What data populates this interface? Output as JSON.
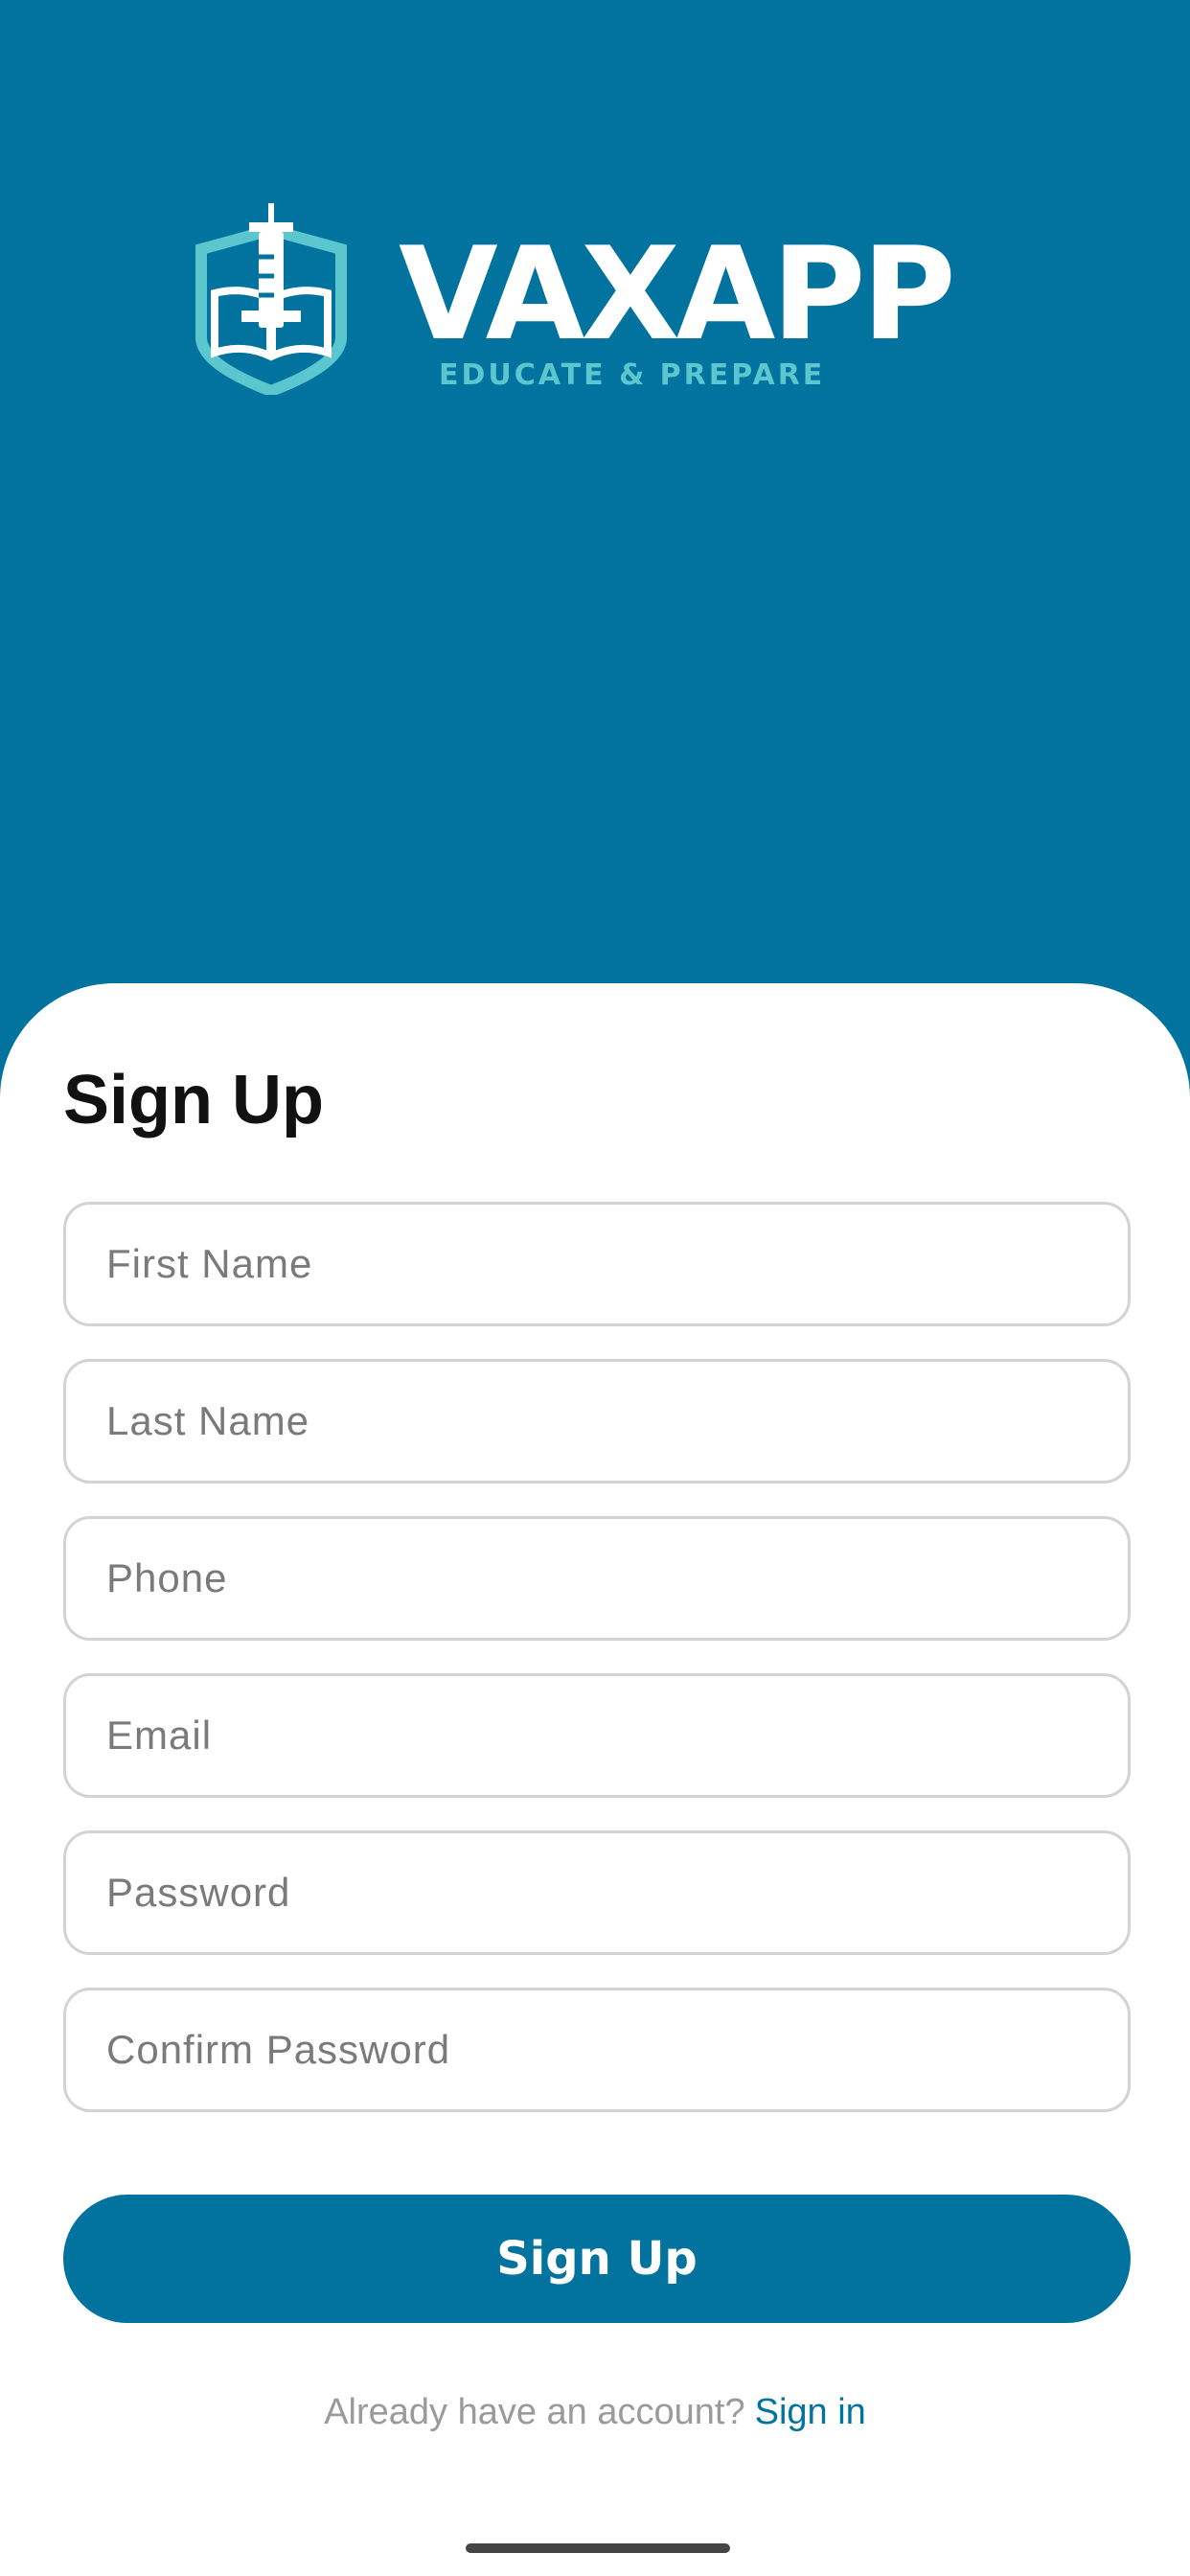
{
  "brand": {
    "name": "VAXAPP",
    "tagline": "EDUCATE & PREPARE",
    "logo_icon": "syringe-book-shield-icon",
    "primary_color": "#01739e",
    "accent_color": "#5cc6cf"
  },
  "form": {
    "title": "Sign Up",
    "fields": {
      "first_name": {
        "placeholder": "First Name",
        "value": ""
      },
      "last_name": {
        "placeholder": "Last Name",
        "value": ""
      },
      "phone": {
        "placeholder": "Phone",
        "value": ""
      },
      "email": {
        "placeholder": "Email",
        "value": ""
      },
      "password": {
        "placeholder": "Password",
        "value": ""
      },
      "confirm_password": {
        "placeholder": "Confirm Password",
        "value": ""
      }
    },
    "submit_label": "Sign Up"
  },
  "footer": {
    "prompt": "Already have an account?",
    "link_label": "Sign in"
  }
}
